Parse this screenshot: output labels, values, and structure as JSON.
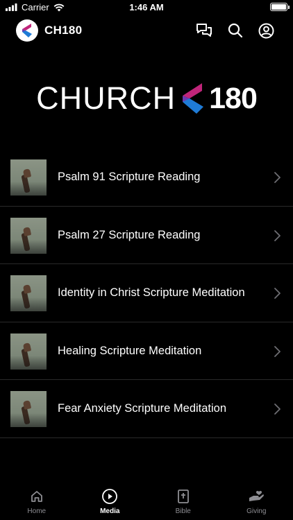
{
  "status_bar": {
    "carrier": "Carrier",
    "time": "1:46 AM"
  },
  "navbar": {
    "title": "CH180",
    "icons": [
      "chat-bubbles-icon",
      "search-icon",
      "profile-icon"
    ]
  },
  "hero": {
    "word": "CHURCH",
    "number": "180"
  },
  "media_items": [
    {
      "title": "Psalm 91 Scripture Reading"
    },
    {
      "title": "Psalm 27 Scripture Reading"
    },
    {
      "title": "Identity in Christ Scripture Meditation"
    },
    {
      "title": "Healing Scripture Meditation"
    },
    {
      "title": "Fear Anxiety Scripture Meditation"
    }
  ],
  "tabs": [
    {
      "label": "Home",
      "icon": "home-icon",
      "active": false
    },
    {
      "label": "Media",
      "icon": "play-circle-icon",
      "active": true
    },
    {
      "label": "Bible",
      "icon": "bible-icon",
      "active": false
    },
    {
      "label": "Giving",
      "icon": "giving-hand-icon",
      "active": false
    }
  ],
  "colors": {
    "background": "#000000",
    "text": "#ffffff",
    "inactive_tab": "#8e8e93",
    "divider": "#2a2a2a",
    "logo_blue": "#1f7bd6",
    "logo_magenta": "#c0257a",
    "logo_purple": "#6a3ab0"
  }
}
